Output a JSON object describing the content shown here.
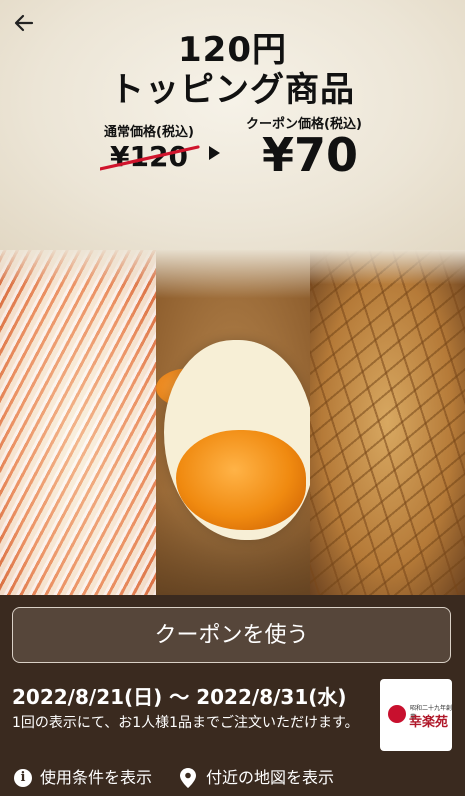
{
  "header": {
    "back_icon": "arrow-left-icon",
    "title_line1": "120円",
    "title_line2": "トッピング商品"
  },
  "price": {
    "normal_label": "通常価格(税込)",
    "normal_value": "¥120",
    "coupon_label": "クーポン価格(税込)",
    "coupon_value": "¥70"
  },
  "photos": [
    "negi-topping",
    "ajitama-egg",
    "menma"
  ],
  "coupon": {
    "use_button": "クーポンを使う",
    "period": "2022/8/21(日) 〜 2022/8/31(水)",
    "note": "1回の表示にて、お1人様1品までご注文いただけます。",
    "logo_tagline": "昭和二十九年創業",
    "logo_name": "幸楽苑"
  },
  "links": {
    "terms_label": "使用条件を表示",
    "terms_icon": "info-icon",
    "map_label": "付近の地図を表示",
    "map_icon": "map-pin-icon"
  },
  "colors": {
    "bottom_bg": "#3a2a1f",
    "button_bg": "#56463a",
    "strike_red": "#d0142c",
    "logo_red": "#c8102e"
  }
}
